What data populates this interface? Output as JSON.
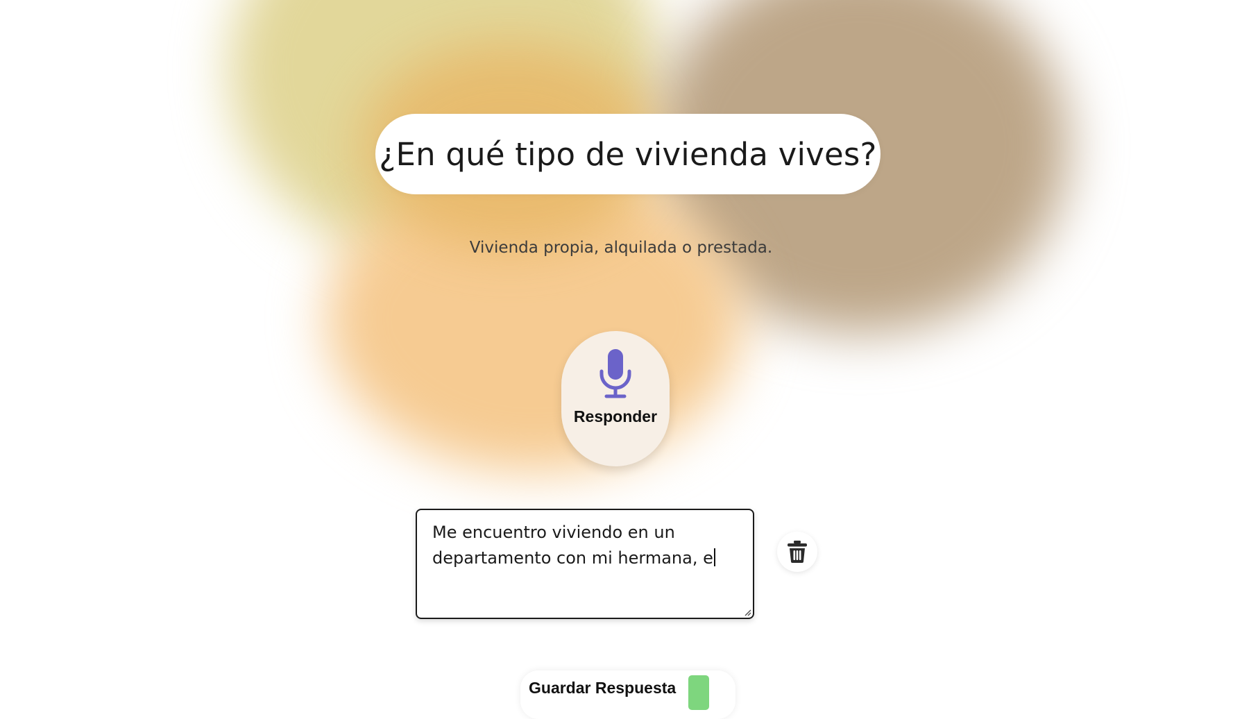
{
  "question": {
    "title": "¿En qué tipo de vivienda vives?",
    "hint": "Vivienda propia, alquilada o prestada."
  },
  "record_button": {
    "label": "Responder",
    "icon": "microphone-icon"
  },
  "answer": {
    "line1": "Me encuentro viviendo en un",
    "line2": "departamento con mi hermana, e"
  },
  "delete_button": {
    "icon": "trash-icon"
  },
  "save_button": {
    "label": "Guardar Respuesta",
    "icon": "save-icon"
  },
  "colors": {
    "mic": "#6b63c9",
    "save_icon": "#7ed67e",
    "blob_yellow": "#e2d79a",
    "blob_orange": "#f6cb92",
    "blob_brown": "#bda688"
  }
}
